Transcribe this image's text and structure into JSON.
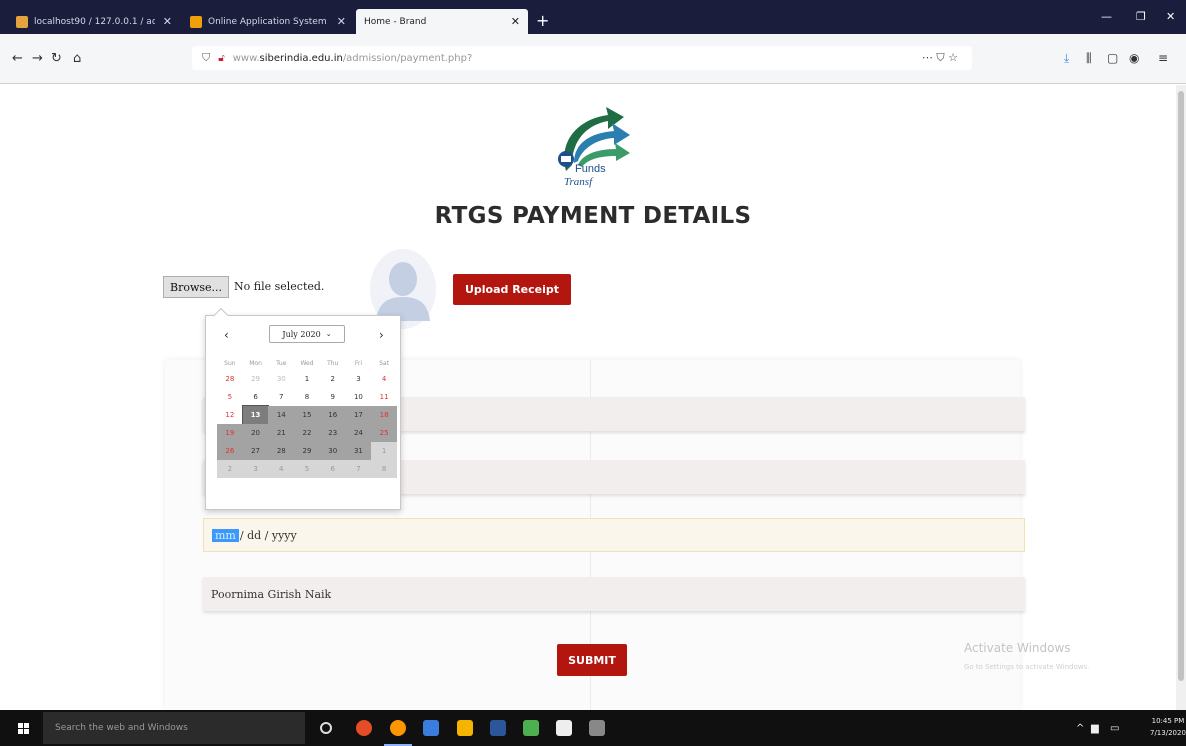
{
  "browser": {
    "tabs": [
      {
        "label": "localhost90 / 127.0.0.1 / adm...",
        "active": false
      },
      {
        "label": "Online Application System",
        "active": false
      },
      {
        "label": "Home - Brand",
        "active": true
      }
    ],
    "new_tab": "+",
    "url_domain": "www.siberindia.edu.in",
    "url_path": "/admission/payment.php?",
    "url_prefix": "www.",
    "url_host_bold": "siberindia.edu.in"
  },
  "page": {
    "logo_text_1": "Funds",
    "logo_text_2": "Transf",
    "title": "RTGS PAYMENT DETAILS",
    "browse_label": "Browse...",
    "no_file_label": "No file selected.",
    "upload_button": "Upload Receipt",
    "date_field": {
      "mm": "mm",
      "rest": "/ dd / yyyy"
    },
    "name_field_value": "Poornima Girish Naik",
    "submit_button": "SUBMIT",
    "activate_title": "Activate Windows",
    "activate_sub": "Go to Settings to activate Windows."
  },
  "datepicker": {
    "month_label": "July 2020",
    "weekdays": [
      "Sun",
      "Mon",
      "Tue",
      "Wed",
      "Thu",
      "Fri",
      "Sat"
    ],
    "weeks": [
      [
        "28",
        "29",
        "30",
        "1",
        "2",
        "3",
        "4"
      ],
      [
        "5",
        "6",
        "7",
        "8",
        "9",
        "10",
        "11"
      ],
      [
        "12",
        "13",
        "14",
        "15",
        "16",
        "17",
        "18"
      ],
      [
        "19",
        "20",
        "21",
        "22",
        "23",
        "24",
        "25"
      ],
      [
        "26",
        "27",
        "28",
        "29",
        "30",
        "31",
        "1"
      ],
      [
        "2",
        "3",
        "4",
        "5",
        "6",
        "7",
        "8"
      ]
    ],
    "today": "13"
  },
  "taskbar": {
    "search_placeholder": "Search the web and Windows",
    "clock_time": "10:45 PM",
    "clock_date": "7/13/2020"
  },
  "colors": {
    "accent_red": "#b3160f",
    "tabstrip": "#1b1d3d"
  }
}
